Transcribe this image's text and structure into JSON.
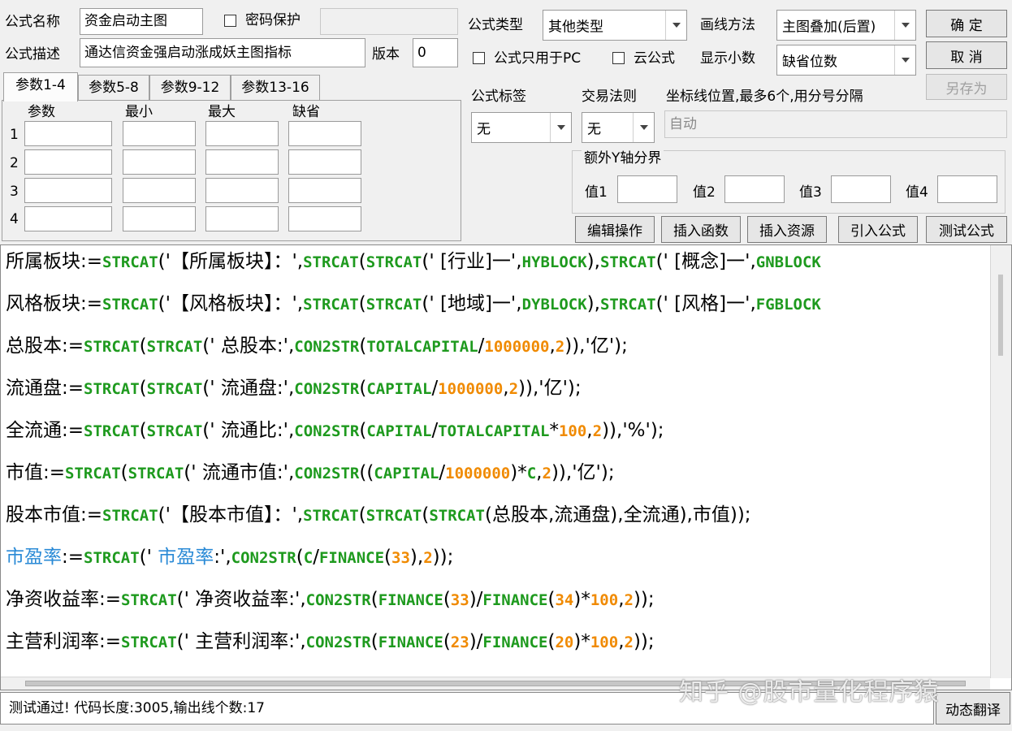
{
  "form": {
    "name_label": "公式名称",
    "name_value": "资金启动主图",
    "password_label": "密码保护",
    "password_value": "",
    "desc_label": "公式描述",
    "desc_value": "通达信资金强启动涨成妖主图指标",
    "version_label": "版本",
    "version_value": "0",
    "type_label": "公式类型",
    "type_value": "其他类型",
    "draw_label": "画线方法",
    "draw_value": "主图叠加(后置)",
    "pc_only_label": "公式只用于PC",
    "cloud_label": "云公式",
    "decimals_label": "显示小数",
    "decimals_value": "缺省位数",
    "tag_label": "公式标签",
    "tag_value": "无",
    "rule_label": "交易法则",
    "rule_value": "无",
    "coord_label": "坐标线位置,最多6个,用分号分隔",
    "coord_value": "自动",
    "yaxis_group_label": "额外Y轴分界",
    "yaxis_values": [
      "值1",
      "值2",
      "值3",
      "值4"
    ]
  },
  "buttons": {
    "ok": "确  定",
    "cancel": "取  消",
    "save_as": "另存为",
    "edit_ops": "编辑操作",
    "insert_func": "插入函数",
    "insert_res": "插入资源",
    "import_formula": "引入公式",
    "test_formula": "测试公式",
    "dynamic_translate": "动态翻译"
  },
  "tabs": [
    "参数1-4",
    "参数5-8",
    "参数9-12",
    "参数13-16"
  ],
  "params": {
    "headers": [
      "参数",
      "最小",
      "最大",
      "缺省"
    ],
    "rows": [
      "1",
      "2",
      "3",
      "4"
    ]
  },
  "code_lines": [
    [
      [
        "所属板块:=",
        "t"
      ],
      [
        "STRCAT",
        "g"
      ],
      [
        "('【所属板块】：',",
        "t"
      ],
      [
        "STRCAT",
        "g"
      ],
      [
        "(",
        "t"
      ],
      [
        "STRCAT",
        "g"
      ],
      [
        "(' [行业]一',",
        "t"
      ],
      [
        "HYBLOCK",
        "g"
      ],
      [
        "),",
        "t"
      ],
      [
        "STRCAT",
        "g"
      ],
      [
        "(' [概念]一',",
        "t"
      ],
      [
        "GNBLOCK",
        "g"
      ]
    ],
    [
      [
        "风格板块:=",
        "t"
      ],
      [
        "STRCAT",
        "g"
      ],
      [
        "('【风格板块】：',",
        "t"
      ],
      [
        "STRCAT",
        "g"
      ],
      [
        "(",
        "t"
      ],
      [
        "STRCAT",
        "g"
      ],
      [
        "(' [地域]一',",
        "t"
      ],
      [
        "DYBLOCK",
        "g"
      ],
      [
        "),",
        "t"
      ],
      [
        "STRCAT",
        "g"
      ],
      [
        "(' [风格]一',",
        "t"
      ],
      [
        "FGBLOCK",
        "g"
      ]
    ],
    [
      [
        "总股本:=",
        "t"
      ],
      [
        "STRCAT",
        "g"
      ],
      [
        "(",
        "t"
      ],
      [
        "STRCAT",
        "g"
      ],
      [
        "(' 总股本:',",
        "t"
      ],
      [
        "CON2STR",
        "g"
      ],
      [
        "(",
        "t"
      ],
      [
        "TOTALCAPITAL",
        "g"
      ],
      [
        "/",
        "t"
      ],
      [
        "1000000",
        "o"
      ],
      [
        ",",
        "t"
      ],
      [
        "2",
        "o"
      ],
      [
        ")),'亿');",
        "t"
      ]
    ],
    [
      [
        "流通盘:=",
        "t"
      ],
      [
        "STRCAT",
        "g"
      ],
      [
        "(",
        "t"
      ],
      [
        "STRCAT",
        "g"
      ],
      [
        "(' 流通盘:',",
        "t"
      ],
      [
        "CON2STR",
        "g"
      ],
      [
        "(",
        "t"
      ],
      [
        "CAPITAL",
        "g"
      ],
      [
        "/",
        "t"
      ],
      [
        "1000000",
        "o"
      ],
      [
        ",",
        "t"
      ],
      [
        "2",
        "o"
      ],
      [
        ")),'亿');",
        "t"
      ]
    ],
    [
      [
        "全流通:=",
        "t"
      ],
      [
        "STRCAT",
        "g"
      ],
      [
        "(",
        "t"
      ],
      [
        "STRCAT",
        "g"
      ],
      [
        "(' 流通比:',",
        "t"
      ],
      [
        "CON2STR",
        "g"
      ],
      [
        "(",
        "t"
      ],
      [
        "CAPITAL",
        "g"
      ],
      [
        "/",
        "t"
      ],
      [
        "TOTALCAPITAL",
        "g"
      ],
      [
        "*",
        "t"
      ],
      [
        "100",
        "o"
      ],
      [
        ",",
        "t"
      ],
      [
        "2",
        "o"
      ],
      [
        ")),'%');",
        "t"
      ]
    ],
    [
      [
        "市值:=",
        "t"
      ],
      [
        "STRCAT",
        "g"
      ],
      [
        "(",
        "t"
      ],
      [
        "STRCAT",
        "g"
      ],
      [
        "(' 流通市值:',",
        "t"
      ],
      [
        "CON2STR",
        "g"
      ],
      [
        "((",
        "t"
      ],
      [
        "CAPITAL",
        "g"
      ],
      [
        "/",
        "t"
      ],
      [
        "1000000",
        "o"
      ],
      [
        ")*",
        "t"
      ],
      [
        "C",
        "g"
      ],
      [
        ",",
        "t"
      ],
      [
        "2",
        "o"
      ],
      [
        ")),'亿');",
        "t"
      ]
    ],
    [
      [
        "股本市值:=",
        "t"
      ],
      [
        "STRCAT",
        "g"
      ],
      [
        "('【股本市值】：',",
        "t"
      ],
      [
        "STRCAT",
        "g"
      ],
      [
        "(",
        "t"
      ],
      [
        "STRCAT",
        "g"
      ],
      [
        "(",
        "t"
      ],
      [
        "STRCAT",
        "g"
      ],
      [
        "(总股本,流通盘),全流通),市值));",
        "t"
      ]
    ],
    [
      [
        "市盈率",
        "b"
      ],
      [
        ":=",
        "t"
      ],
      [
        "STRCAT",
        "g"
      ],
      [
        "(' ",
        "t"
      ],
      [
        "市盈率",
        "b"
      ],
      [
        ":',",
        "t"
      ],
      [
        "CON2STR",
        "g"
      ],
      [
        "(",
        "t"
      ],
      [
        "C",
        "g"
      ],
      [
        "/",
        "t"
      ],
      [
        "FINANCE",
        "g"
      ],
      [
        "(",
        "t"
      ],
      [
        "33",
        "o"
      ],
      [
        "),",
        "t"
      ],
      [
        "2",
        "o"
      ],
      [
        "));",
        "t"
      ]
    ],
    [
      [
        "净资收益率:=",
        "t"
      ],
      [
        "STRCAT",
        "g"
      ],
      [
        "(' 净资收益率:',",
        "t"
      ],
      [
        "CON2STR",
        "g"
      ],
      [
        "(",
        "t"
      ],
      [
        "FINANCE",
        "g"
      ],
      [
        "(",
        "t"
      ],
      [
        "33",
        "o"
      ],
      [
        ")/",
        "t"
      ],
      [
        "FINANCE",
        "g"
      ],
      [
        "(",
        "t"
      ],
      [
        "34",
        "o"
      ],
      [
        ")*",
        "t"
      ],
      [
        "100",
        "o"
      ],
      [
        ",",
        "t"
      ],
      [
        "2",
        "o"
      ],
      [
        "));",
        "t"
      ]
    ],
    [
      [
        "主营利润率:=",
        "t"
      ],
      [
        "STRCAT",
        "g"
      ],
      [
        "(' 主营利润率:',",
        "t"
      ],
      [
        "CON2STR",
        "g"
      ],
      [
        "(",
        "t"
      ],
      [
        "FINANCE",
        "g"
      ],
      [
        "(",
        "t"
      ],
      [
        "23",
        "o"
      ],
      [
        ")/",
        "t"
      ],
      [
        "FINANCE",
        "g"
      ],
      [
        "(",
        "t"
      ],
      [
        "20",
        "o"
      ],
      [
        ")*",
        "t"
      ],
      [
        "100",
        "o"
      ],
      [
        ",",
        "t"
      ],
      [
        "2",
        "o"
      ],
      [
        "));",
        "t"
      ]
    ]
  ],
  "code_colors": {
    "t": "#000000",
    "g": "#1e9a1e",
    "o": "#f08a00",
    "b": "#2a8ad6"
  },
  "status_text": "测试通过! 代码长度:3005,输出线个数:17",
  "watermark": "知乎 @股市量化程序猿"
}
